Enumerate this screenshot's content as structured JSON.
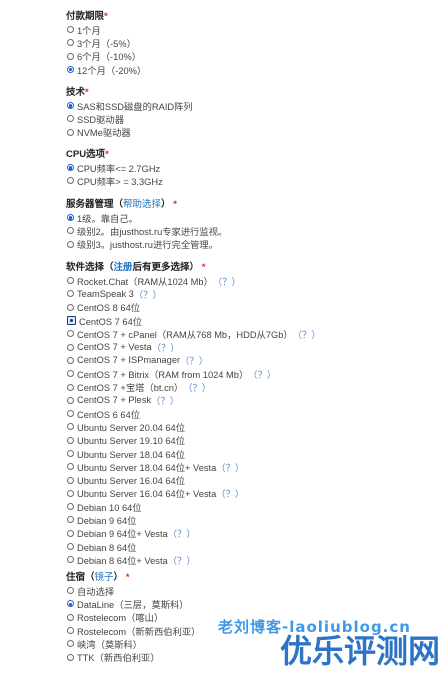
{
  "billing": {
    "title": "付款期限",
    "required": "*",
    "options": [
      {
        "label": "1个月",
        "checked": false
      },
      {
        "label": "3个月（-5%）",
        "checked": false
      },
      {
        "label": "6个月（-10%）",
        "checked": false
      },
      {
        "label": "12个月（-20%）",
        "checked": true
      }
    ]
  },
  "tech": {
    "title": "技术",
    "required": "*",
    "options": [
      {
        "label": "SAS和SSD磁盘的RAID阵列",
        "checked": true
      },
      {
        "label": "SSD驱动器",
        "checked": false
      },
      {
        "label": "NVMe驱动器",
        "checked": false
      }
    ]
  },
  "cpu": {
    "title": "CPU选项",
    "required": "*",
    "options": [
      {
        "label": "CPU频率<= 2.7GHz",
        "checked": true
      },
      {
        "label": "CPU频率> = 3.3GHz",
        "checked": false
      }
    ]
  },
  "management": {
    "title_prefix": "服务器管理（",
    "help_link": "帮助选择",
    "title_suffix": "）",
    "required": "*",
    "options": [
      {
        "label": "1级。靠自己。",
        "checked": true
      },
      {
        "label": "级别2。由justhost.ru专家进行监视。",
        "checked": false
      },
      {
        "label": "级别3。justhost.ru进行完全管理。",
        "checked": false
      }
    ]
  },
  "software": {
    "title_prefix": "软件选择（",
    "register_link": "注册",
    "title_suffix": "后有更多选择）",
    "required": "*",
    "options": [
      {
        "label": "Rocket.Chat（RAM从1024 Mb）",
        "help": "（？）",
        "checked": false
      },
      {
        "label": "TeamSpeak 3",
        "help": "（？）",
        "checked": false
      },
      {
        "label": "CentOS 8 64位",
        "help": "",
        "checked": false
      },
      {
        "label": "CentOS 7 64位",
        "help": "",
        "checked": true
      },
      {
        "label": "CentOS 7 + cPanel（RAM从768 Mb，HDD从7Gb）",
        "help": "（？）",
        "checked": false
      },
      {
        "label": "CentOS 7 + Vesta",
        "help": "（？）",
        "checked": false
      },
      {
        "label": "CentOS 7 + ISPmanager",
        "help": "（？）",
        "checked": false
      },
      {
        "label": "CentOS 7 + Bitrix（RAM from 1024 Mb）",
        "help": "（？）",
        "checked": false
      },
      {
        "label": "CentOS 7 +宝塔（bt.cn）",
        "help": "（？）",
        "checked": false
      },
      {
        "label": "CentOS 7 + Plesk",
        "help": "（？）",
        "checked": false
      },
      {
        "label": "CentOS 6 64位",
        "help": "",
        "checked": false
      },
      {
        "label": "Ubuntu Server 20.04 64位",
        "help": "",
        "checked": false
      },
      {
        "label": "Ubuntu Server 19.10 64位",
        "help": "",
        "checked": false
      },
      {
        "label": "Ubuntu Server 18.04 64位",
        "help": "",
        "checked": false
      },
      {
        "label": "Ubuntu Server 18.04 64位+ Vesta",
        "help": "（？）",
        "checked": false
      },
      {
        "label": "Ubuntu Server 16.04 64位",
        "help": "",
        "checked": false
      },
      {
        "label": "Ubuntu Server 16.04 64位+ Vesta",
        "help": "（？）",
        "checked": false
      },
      {
        "label": "Debian 10 64位",
        "help": "",
        "checked": false
      },
      {
        "label": "Debian 9 64位",
        "help": "",
        "checked": false
      },
      {
        "label": "Debian 9 64位+ Vesta",
        "help": "（？）",
        "checked": false
      },
      {
        "label": "Debian 8 64位",
        "help": "",
        "checked": false
      },
      {
        "label": "Debian 8 64位+ Vesta",
        "help": "（？）",
        "checked": false
      }
    ]
  },
  "location": {
    "title_prefix": "住宿（",
    "mirror_link": "镜子",
    "title_suffix": "）",
    "required": "*",
    "options": [
      {
        "label": "自动选择",
        "checked": false
      },
      {
        "label": "DataLine（三层，莫斯科）",
        "checked": true
      },
      {
        "label": "Rostelecom（喀山）",
        "checked": false
      },
      {
        "label": "Rostelecom（新新西伯利亚）",
        "checked": false
      },
      {
        "label": "峡湾（莫斯科）",
        "checked": false
      },
      {
        "label": "TTK（新西伯利亚）",
        "checked": false
      }
    ]
  },
  "watermark": {
    "small": "老刘博客-laoliublog.cn",
    "big": "优乐评测网"
  },
  "colors": {
    "required": "#d9302c",
    "link": "#1e73be",
    "radio_checked": "#1a5fd0"
  }
}
